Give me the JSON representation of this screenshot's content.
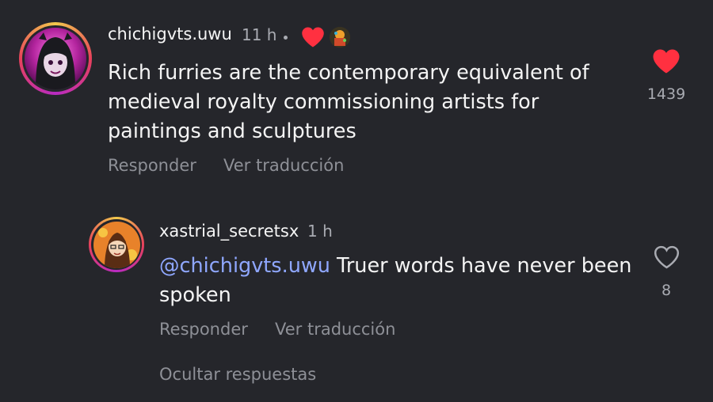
{
  "comments": [
    {
      "username": "chichigvts.uwu",
      "time": "11 h",
      "text": "Rich furries are the contemporary equivalent of medieval royalty commissioning artists for paintings and sculptures",
      "likes": "1439",
      "liked": true,
      "reply_label": "Responder",
      "translate_label": "Ver traducción"
    },
    {
      "username": "xastrial_secretsx",
      "time": "1 h",
      "mention": "@chichigvts.uwu",
      "text": " Truer words have never been spoken",
      "likes": "8",
      "liked": false,
      "reply_label": "Responder",
      "translate_label": "Ver traducción"
    }
  ],
  "hide_replies_label": "Ocultar respuestas",
  "colors": {
    "background": "#25262b",
    "like_red": "#ff3040",
    "mention": "#8fa7ff",
    "muted": "#8e9097"
  },
  "icons": [
    "heart-filled-icon",
    "heart-outline-icon",
    "creator-liked-heart-icon",
    "creator-avatar-badge-icon"
  ]
}
